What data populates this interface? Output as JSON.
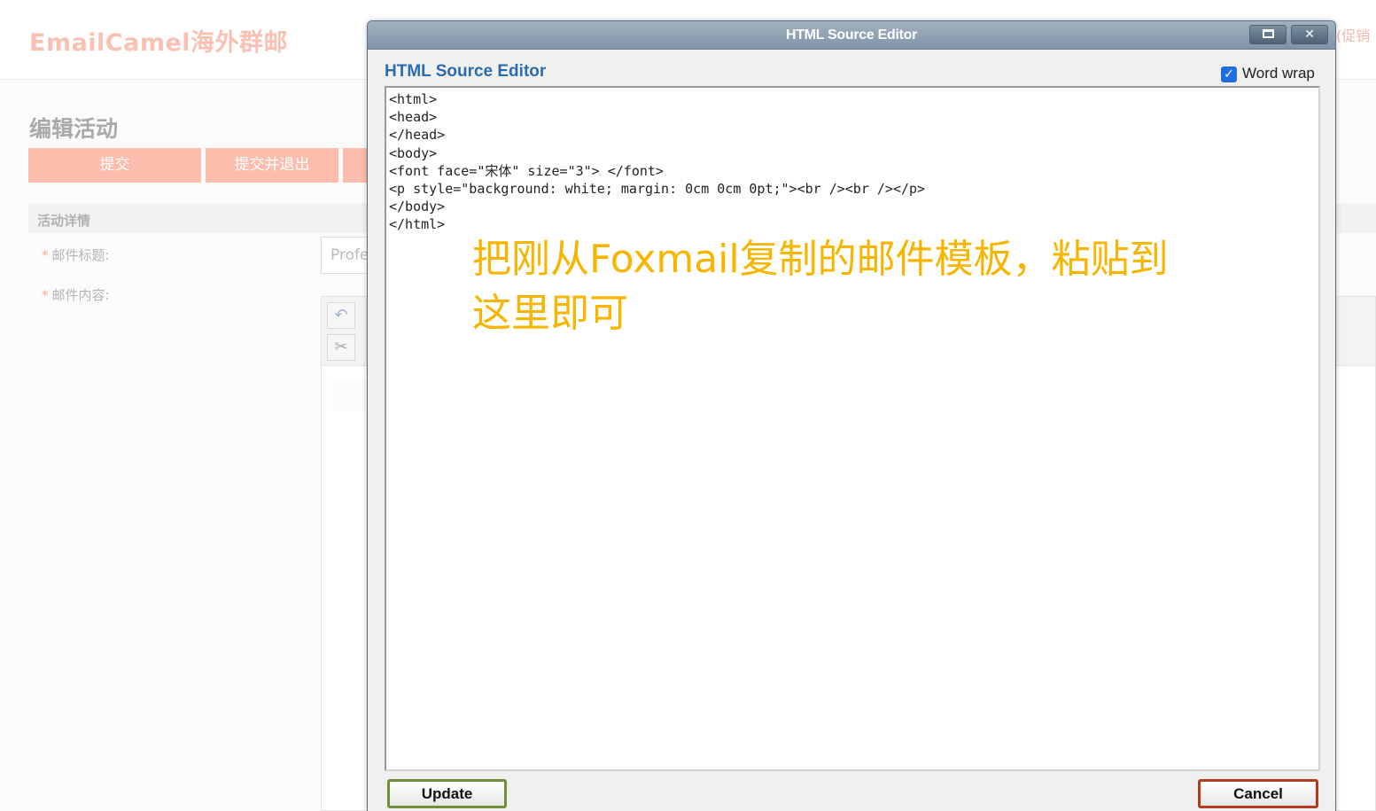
{
  "app": {
    "brand": "EmailCamel海外群邮",
    "top_right_text": "(促销"
  },
  "page": {
    "title": "编辑活动",
    "buttons": {
      "submit": "提交",
      "submit_exit": "提交并退出",
      "third": ""
    },
    "section_title": "活动详情",
    "fields": {
      "required_mark": "*",
      "subject_label": "邮件标题:",
      "subject_value": "Profe",
      "content_label": "邮件内容:"
    },
    "toolbar_icons": [
      "undo-icon",
      "cut-icon"
    ]
  },
  "dialog": {
    "title": "HTML Source Editor",
    "heading": "HTML Source Editor",
    "word_wrap_label": "Word wrap",
    "word_wrap_checked": true,
    "source_lines": [
      "<html>",
      "<head>",
      "</head>",
      "<body>",
      "<font face=\"宋体\" size=\"3\"> </font>",
      "<p style=\"background: white; margin: 0cm 0cm 0pt;\"><br /><br /></p>",
      "</body>",
      "</html>"
    ],
    "annotation": "把刚从Foxmail复制的邮件模板，粘贴到这里即可",
    "update_label": "Update",
    "cancel_label": "Cancel",
    "window_buttons": [
      "maximize-icon",
      "close-icon"
    ],
    "colors": {
      "heading": "#2b6cb0",
      "annotation": "#f7b500",
      "update_border": "#6f8f3a",
      "cancel_border": "#b23c22",
      "checkbox": "#1f6fe0"
    }
  }
}
